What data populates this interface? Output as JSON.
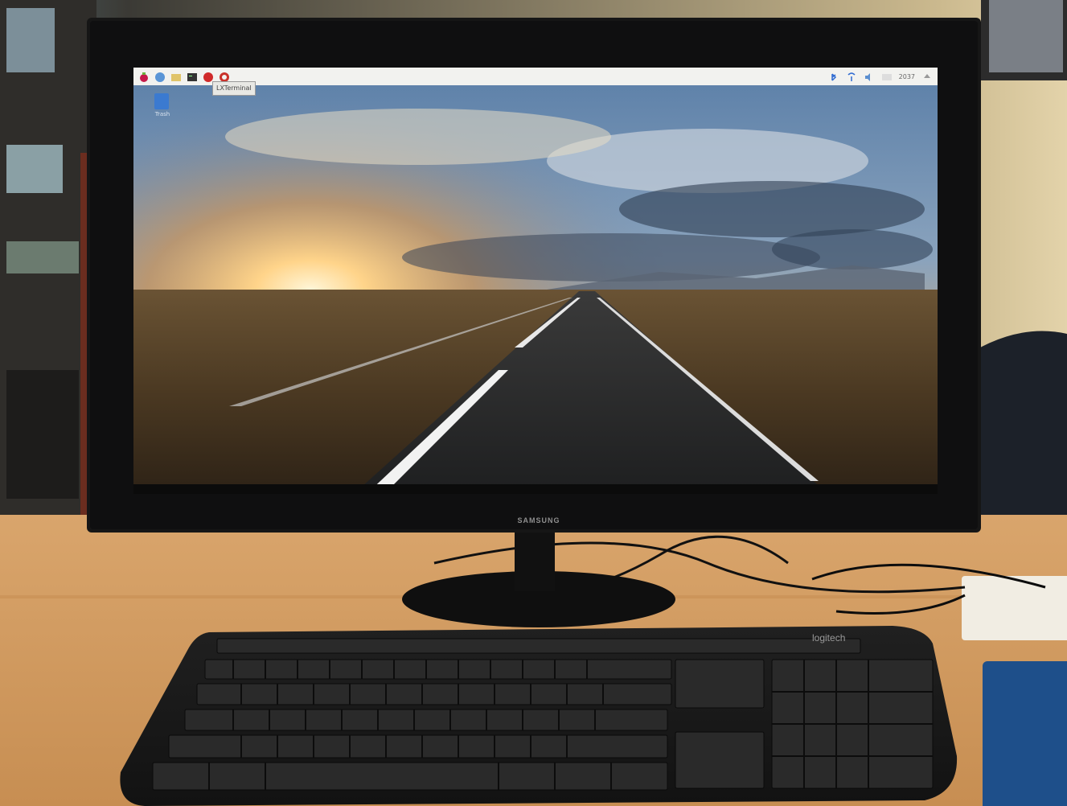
{
  "scene": {
    "description_free": true,
    "monitor_brand": "SAMSUNG",
    "keyboard_brand": "logitech"
  },
  "desktop": {
    "taskbar": {
      "right_clock": "2037"
    },
    "icons": [
      {
        "label": "Trash"
      }
    ],
    "tooltip": "LXTerminal"
  },
  "colors": {
    "wall": "#d9c9a4",
    "desk": "#d6a268",
    "monitor_bezel": "#141414",
    "sky_blue": "#5d86b7",
    "sun": "#ffd48a",
    "road": "#2a2b2c",
    "taskbar": "#f2f2ef"
  }
}
